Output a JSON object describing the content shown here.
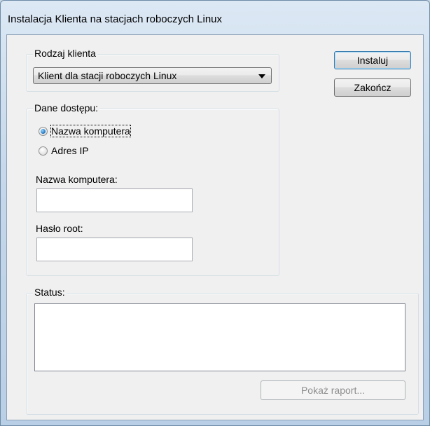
{
  "window": {
    "title": "Instalacja Klienta na stacjach roboczych Linux"
  },
  "client_type": {
    "group_label": "Rodzaj klienta",
    "selected": "Klient dla stacji roboczych Linux"
  },
  "buttons": {
    "install": "Instaluj",
    "finish": "Zakończ",
    "show_report": "Pokaż raport..."
  },
  "access": {
    "group_label": "Dane dostępu:",
    "options": [
      {
        "label": "Nazwa komputera",
        "checked": true
      },
      {
        "label": "Adres IP",
        "checked": false
      }
    ],
    "computer_name_label": "Nazwa komputera:",
    "computer_name_value": "",
    "root_password_label": "Hasło root:",
    "root_password_value": ""
  },
  "status": {
    "group_label": "Status:",
    "text": ""
  }
}
